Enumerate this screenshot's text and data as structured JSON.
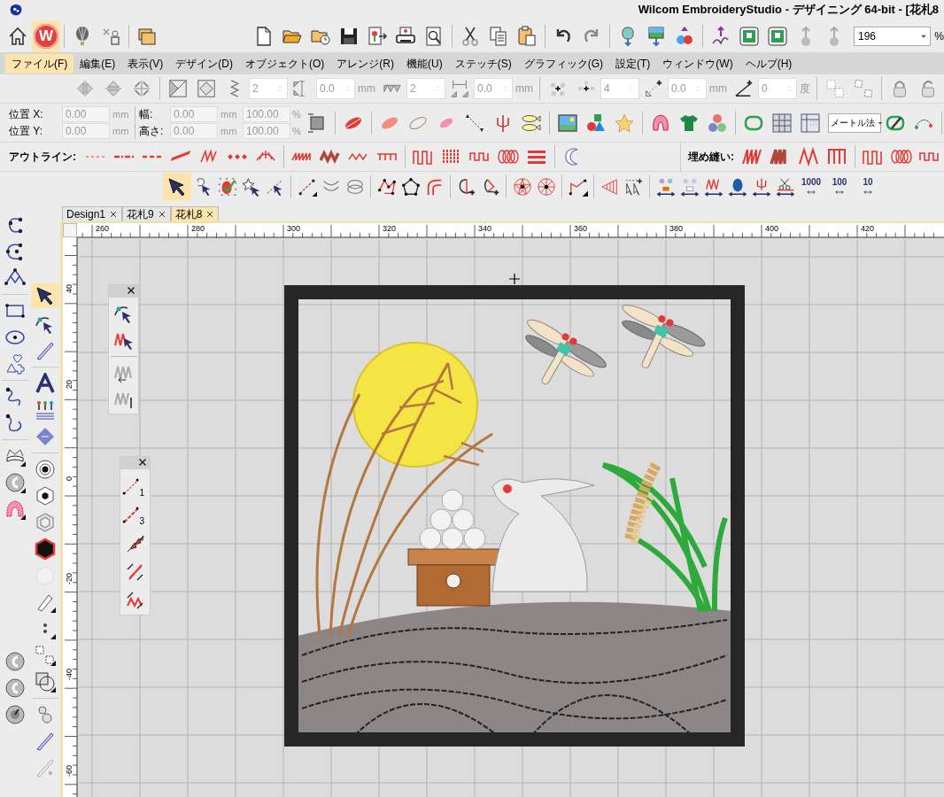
{
  "window": {
    "title": "Wilcom EmbroideryStudio - デザイニング 64-bit - [花札8"
  },
  "app_button": {
    "letter": "W"
  },
  "zoom_box": {
    "value": "196",
    "unit": "%"
  },
  "menu": [
    {
      "label": "ファイル(F)",
      "selected": true
    },
    {
      "label": "編集(E)",
      "selected": false
    },
    {
      "label": "表示(V)",
      "selected": false
    },
    {
      "label": "デザイン(D)",
      "selected": false
    },
    {
      "label": "オブジェクト(O)",
      "selected": false
    },
    {
      "label": "アレンジ(R)",
      "selected": false
    },
    {
      "label": "機能(U)",
      "selected": false
    },
    {
      "label": "ステッチ(S)",
      "selected": false
    },
    {
      "label": "グラフィック(G)",
      "selected": false
    },
    {
      "label": "設定(T)",
      "selected": false
    },
    {
      "label": "ウィンドウ(W)",
      "selected": false
    },
    {
      "label": "ヘルプ(H)",
      "selected": false
    }
  ],
  "transform_toolbar": {
    "fields": [
      {
        "value": "2",
        "disabled": true
      },
      {
        "value": "0.0",
        "unit": "mm",
        "disabled": true
      },
      {
        "value": "2",
        "disabled": true
      },
      {
        "value": "0.0",
        "unit": "mm",
        "disabled": true
      },
      {
        "value": "4",
        "disabled": true
      },
      {
        "value": "0.0",
        "unit": "mm",
        "disabled": true
      },
      {
        "value": "0",
        "unit": "度",
        "disabled": true
      }
    ]
  },
  "property_bar": {
    "rows": [
      {
        "pos_label": "位置 X:",
        "pos_value": "0.00",
        "pos_unit": "mm",
        "size_label": "幅:",
        "size_value": "0.00",
        "size_unit": "mm",
        "scale_value": "100.00",
        "scale_unit": "%"
      },
      {
        "pos_label": "位置 Y:",
        "pos_value": "0.00",
        "pos_unit": "mm",
        "size_label": "高さ:",
        "size_value": "0.00",
        "size_unit": "mm",
        "scale_value": "100.00",
        "scale_unit": "%"
      }
    ],
    "units_dropdown": "メートル法"
  },
  "outline_label": "アウトライン:",
  "fill_label": "埋め縫い:",
  "stitch_count_buttons": [
    "1000",
    "100",
    "10"
  ],
  "tabs": [
    {
      "label": "Design1",
      "selected": false
    },
    {
      "label": "花札9",
      "selected": false
    },
    {
      "label": "花札8",
      "selected": true
    }
  ],
  "ruler": {
    "x_labels": [
      "260",
      "280",
      "300",
      "320",
      "340",
      "360",
      "380",
      "400",
      "420"
    ],
    "y_labels": [
      "40",
      "20",
      "0",
      "-20",
      "-40",
      "-60"
    ]
  },
  "floating_toolbar": {
    "numbers": [
      "1",
      "3"
    ]
  }
}
